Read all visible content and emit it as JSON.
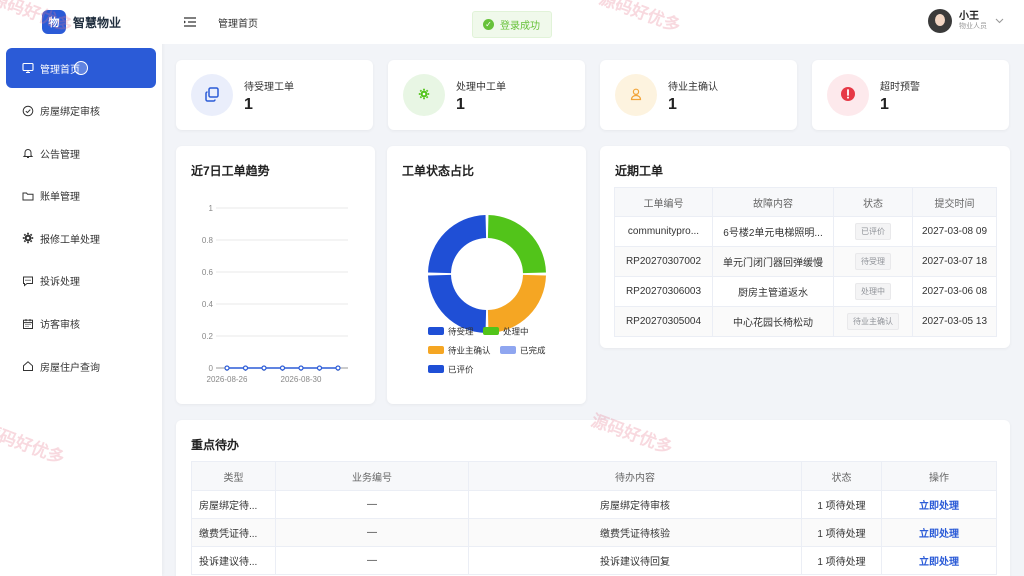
{
  "brand": {
    "logo_char": "物",
    "name": "智慧物业"
  },
  "sidebar": {
    "items": [
      {
        "label": "管理首页",
        "icon": "monitor-icon",
        "active": true
      },
      {
        "label": "房屋绑定审核",
        "icon": "check-circle-icon"
      },
      {
        "label": "公告管理",
        "icon": "bell-icon"
      },
      {
        "label": "账单管理",
        "icon": "folder-icon"
      },
      {
        "label": "报修工单处理",
        "icon": "gear-icon"
      },
      {
        "label": "投诉处理",
        "icon": "chat-icon"
      },
      {
        "label": "访客审核",
        "icon": "calendar-icon"
      },
      {
        "label": "房屋住户查询",
        "icon": "house-icon"
      }
    ]
  },
  "header": {
    "breadcrumb": "管理首页",
    "toast": "登录成功",
    "user_name": "小王",
    "user_role": "物业人员"
  },
  "stats": [
    {
      "label": "待受理工单",
      "value": "1",
      "icon": "copy-icon",
      "bg": "#eaeefb",
      "color": "#2b5bd7"
    },
    {
      "label": "处理中工单",
      "value": "1",
      "icon": "gear-icon",
      "bg": "#e8f6e4",
      "color": "#52c41a"
    },
    {
      "label": "待业主确认",
      "value": "1",
      "icon": "user-icon",
      "bg": "#fdf3df",
      "color": "#f2a43a"
    },
    {
      "label": "超时预警",
      "value": "1",
      "icon": "alert-icon",
      "bg": "#fde9ec",
      "color": "#e63946"
    }
  ],
  "trend": {
    "title": "近7日工单趋势",
    "chart_data": {
      "type": "line",
      "x": [
        "2026-08-26",
        "2026-08-27",
        "2026-08-28",
        "2026-08-29",
        "2026-08-30",
        "2026-08-31",
        "2026-09-01"
      ],
      "x_tick_labels": [
        "2026-08-26",
        "2026-08-30"
      ],
      "values": [
        0,
        0,
        0,
        0,
        0,
        0,
        0
      ],
      "ylim": [
        0,
        1
      ],
      "yticks": [
        "0",
        "0.2",
        "0.4",
        "0.6",
        "0.8",
        "1"
      ],
      "color": "#2b5bd7",
      "grid": true
    }
  },
  "status_chart": {
    "title": "工单状态占比",
    "chart_data": {
      "type": "pie",
      "donut": true,
      "slices": [
        {
          "name": "待受理",
          "value": 1,
          "color": "#1f4fd6"
        },
        {
          "name": "处理中",
          "value": 1,
          "color": "#52c41a"
        },
        {
          "name": "待业主确认",
          "value": 1,
          "color": "#f5a623"
        },
        {
          "name": "已完成",
          "value": 0,
          "color": "#8fa6f0"
        },
        {
          "name": "已评价",
          "value": 1,
          "color": "#1f4fd6"
        }
      ],
      "legend": "bottom"
    }
  },
  "recent": {
    "title": "近期工单",
    "columns": [
      "工单编号",
      "故障内容",
      "状态",
      "提交时间"
    ],
    "rows": [
      {
        "id": "communitypro...",
        "content": "6号楼2单元电梯照明...",
        "status": "已评价",
        "time": "2027-03-08 09"
      },
      {
        "id": "RP20270307002",
        "content": "单元门闭门器回弹缓慢",
        "status": "待受理",
        "time": "2027-03-07 18"
      },
      {
        "id": "RP20270306003",
        "content": "厨房主管道返水",
        "status": "处理中",
        "time": "2027-03-06 08"
      },
      {
        "id": "RP20270305004",
        "content": "中心花园长椅松动",
        "status": "待业主确认",
        "time": "2027-03-05 13"
      }
    ]
  },
  "todo": {
    "title": "重点待办",
    "columns": [
      "类型",
      "业务编号",
      "待办内容",
      "状态",
      "操作"
    ],
    "rows": [
      {
        "type": "房屋绑定待...",
        "no": "—",
        "content": "房屋绑定待审核",
        "status": "1 项待处理",
        "action": "立即处理"
      },
      {
        "type": "缴费凭证待...",
        "no": "—",
        "content": "缴费凭证待核验",
        "status": "1 项待处理",
        "action": "立即处理"
      },
      {
        "type": "投诉建议待...",
        "no": "—",
        "content": "投诉建议待回复",
        "status": "1 项待处理",
        "action": "立即处理"
      }
    ]
  },
  "watermark": {
    "text": "源码好优多"
  }
}
